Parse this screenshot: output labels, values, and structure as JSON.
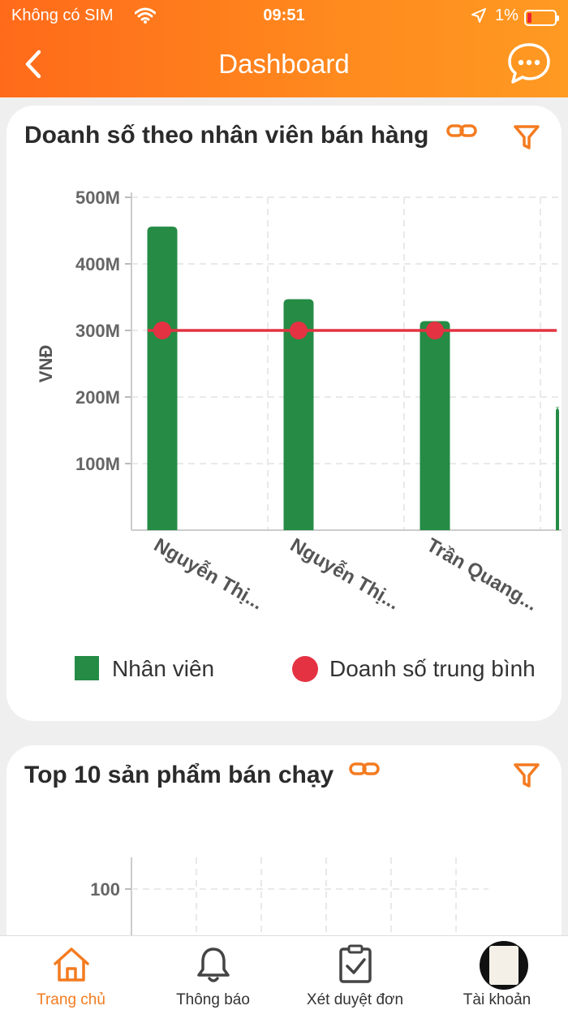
{
  "status_bar": {
    "carrier": "Không có SIM",
    "time": "09:51",
    "battery": "1%"
  },
  "header": {
    "title": "Dashboard",
    "back_icon": "chevron-left-icon",
    "chat_icon": "chat-bubble-icon"
  },
  "card1": {
    "title": "Doanh số theo nhân viên bán hàng",
    "chart_data": {
      "type": "bar",
      "ylabel": "VNĐ",
      "y_ticks": [
        "500M",
        "400M",
        "300M",
        "200M",
        "100M"
      ],
      "ylim": [
        0,
        500
      ],
      "categories": [
        "Nguyễn Thị...",
        "Nguyễn Thị...",
        "Trần Quang...",
        ""
      ],
      "series": [
        {
          "name": "Nhân viên",
          "type": "bar",
          "color": "#258b45",
          "values": [
            456,
            347,
            314,
            185
          ]
        },
        {
          "name": "Doanh số trung bình",
          "type": "line",
          "color": "#e43242",
          "values": [
            300,
            300,
            300,
            300
          ]
        }
      ],
      "grid": true,
      "legend_position": "bottom"
    }
  },
  "card2": {
    "title": "Top 10 sản phẩm bán chạy",
    "chart_data": {
      "type": "bar",
      "y_ticks": [
        "100"
      ],
      "grid": true
    }
  },
  "tabbar": {
    "items": [
      {
        "label": "Trang chủ",
        "icon": "home-icon",
        "active": true
      },
      {
        "label": "Thông báo",
        "icon": "bell-icon",
        "active": false
      },
      {
        "label": "Xét duyệt đơn",
        "icon": "clipboard-check-icon",
        "active": false
      },
      {
        "label": "Tài khoản",
        "icon": "avatar-icon",
        "active": false
      }
    ]
  },
  "colors": {
    "accent": "#f47b20",
    "bar": "#258b45",
    "average": "#e43242"
  }
}
